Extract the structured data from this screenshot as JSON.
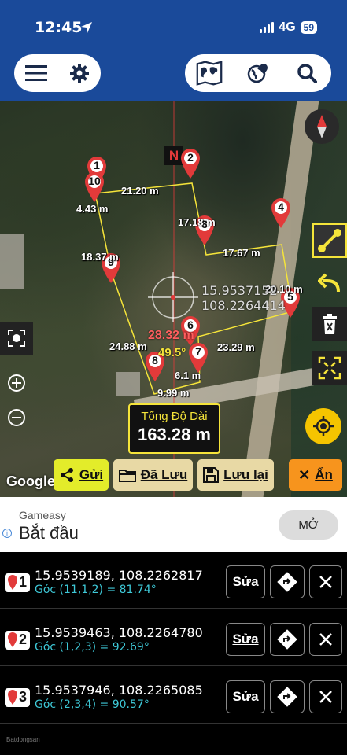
{
  "status": {
    "time": "12:45",
    "network": "4G",
    "battery": "59"
  },
  "map": {
    "north_label": "N",
    "coord_line1": "15.9537152",
    "coord_line2": "108.2264414",
    "angle_red": "28.32 m",
    "angle_yellow": "49.5°",
    "pins": [
      "1",
      "2",
      "3",
      "4",
      "5",
      "6",
      "7",
      "8",
      "9",
      "10"
    ],
    "edge_labels": [
      "21.20 m",
      "4.43 m",
      "17.18 m",
      "17.67 m",
      "18.37 m",
      "20.10 m",
      "24.88 m",
      "23.29 m",
      "6.1 m",
      "9.99 m"
    ],
    "google_logo": "Google"
  },
  "total": {
    "label": "Tổng Độ Dài",
    "value": "163.28 m"
  },
  "buttons": {
    "send": "Gửi",
    "saved": "Đã Lưu",
    "save": "Lưu lại",
    "hide": "Ẩn"
  },
  "ad": {
    "source": "Gameasy",
    "title": "Bắt đầu",
    "open": "MỞ",
    "info": "i"
  },
  "points": [
    {
      "num": "1",
      "coords": "15.9539189, 108.2262817",
      "angle": "Góc (11,1,2) = 81.74°",
      "edit": "Sửa"
    },
    {
      "num": "2",
      "coords": "15.9539463, 108.2264780",
      "angle": "Góc (1,2,3) = 92.69°",
      "edit": "Sửa"
    },
    {
      "num": "3",
      "coords": "15.9537946, 108.2265085",
      "angle": "Góc (2,3,4) = 90.57°",
      "edit": "Sửa"
    }
  ],
  "watermark": "Batdongsan",
  "colors": {
    "header": "#1a4a9a",
    "accent": "#f5e43a",
    "pin": "#e23a3a",
    "angle_text": "#3ec9d8"
  }
}
